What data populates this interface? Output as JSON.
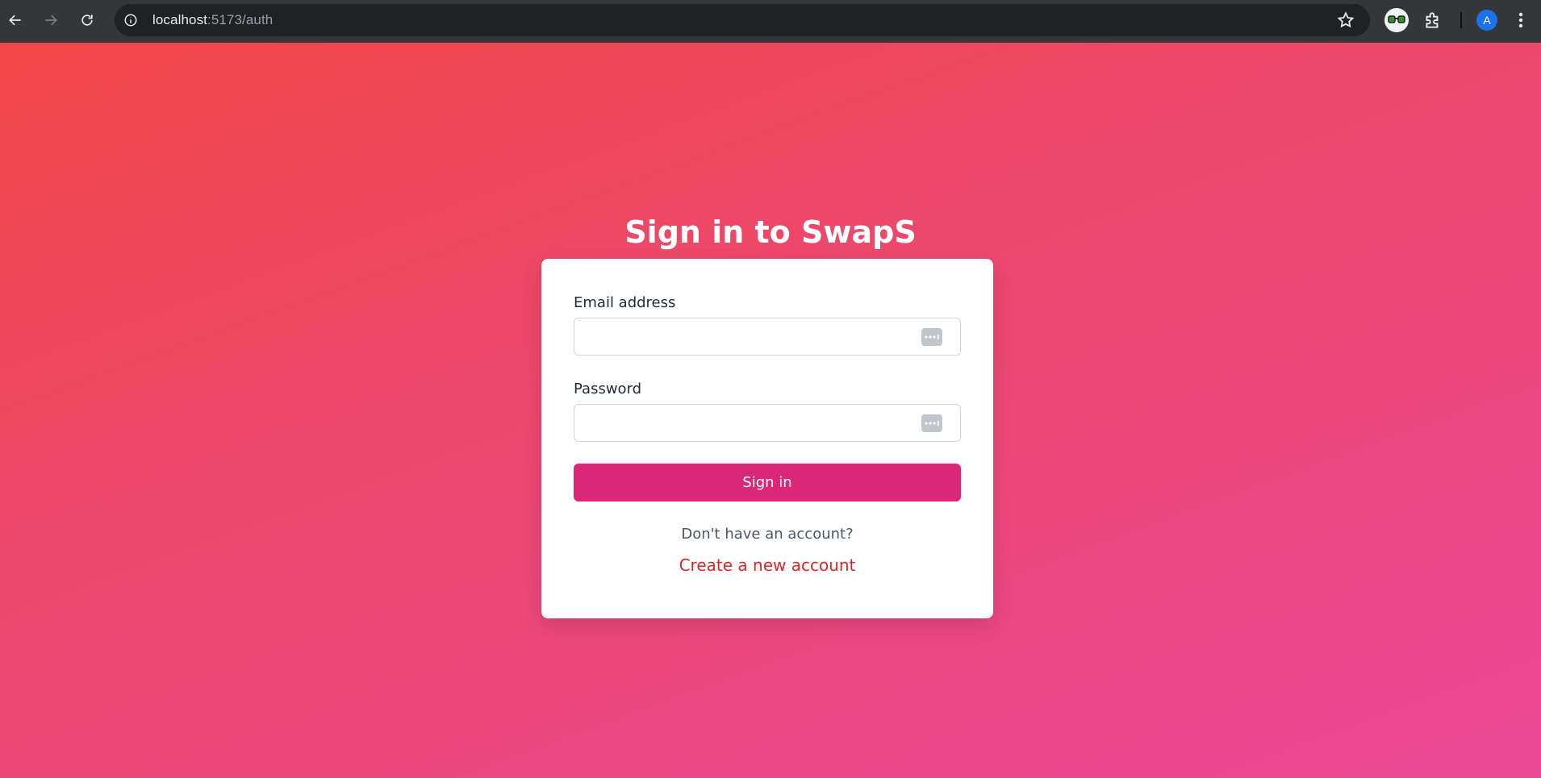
{
  "browser": {
    "url_host": "localhost",
    "url_rest": ":5173/auth",
    "profile_initial": "A"
  },
  "page": {
    "title": "Sign in to SwapS",
    "form": {
      "email_label": "Email address",
      "email_value": "",
      "password_label": "Password",
      "password_value": "",
      "submit_label": "Sign in"
    },
    "footer": {
      "prompt": "Don't have an account?",
      "create_link": "Create a new account"
    }
  },
  "colors": {
    "primary_button": "#db2777",
    "link": "#dc2626",
    "background_start": "#f04646",
    "background_end": "#ec4795"
  }
}
